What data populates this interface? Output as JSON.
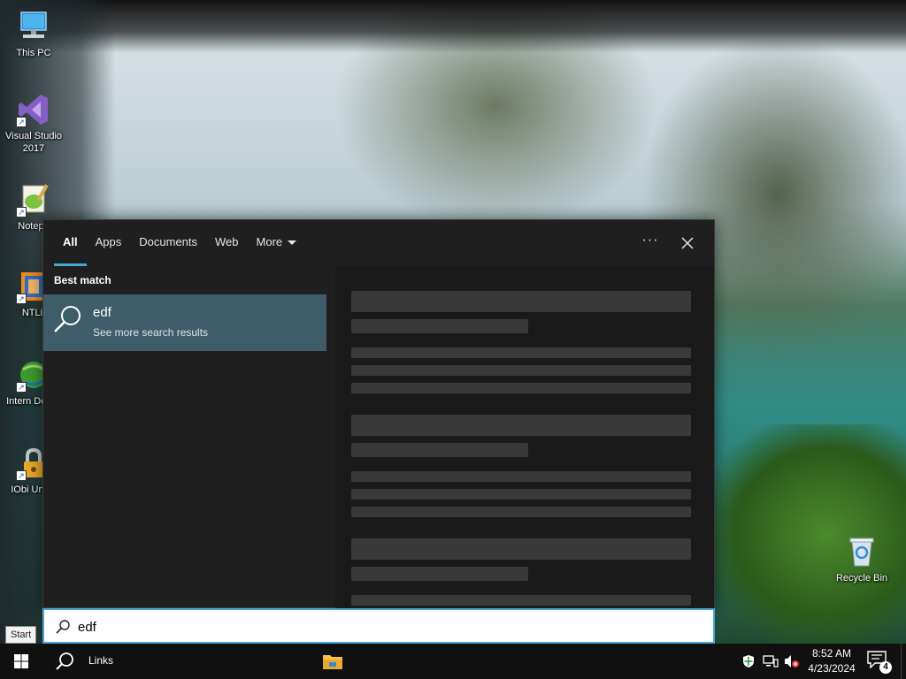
{
  "desktop": {
    "icons": [
      {
        "label": "This PC"
      },
      {
        "label": "Visual Studio 2017"
      },
      {
        "label": "Notepa"
      },
      {
        "label": "NTLit"
      },
      {
        "label": "Intern Downl"
      },
      {
        "label": "IObi Unloc"
      },
      {
        "label": "Recycle Bin"
      }
    ]
  },
  "search": {
    "tabs": [
      {
        "label": "All",
        "active": true
      },
      {
        "label": "Apps"
      },
      {
        "label": "Documents"
      },
      {
        "label": "Web"
      },
      {
        "label": "More"
      }
    ],
    "more_options_label": "···",
    "best_match_label": "Best match",
    "result": {
      "title": "edf",
      "subtitle": "See more search results",
      "icon": "search-icon"
    },
    "query": "edf"
  },
  "tooltip": {
    "start": "Start"
  },
  "taskbar": {
    "links_label": "Links",
    "clock": {
      "time": "8:52 AM",
      "date": "4/23/2024"
    },
    "notification_count": "4"
  },
  "colors": {
    "accent": "#4aa6d8",
    "result_highlight": "#3f5d69",
    "panel_bg": "#1f1f1f",
    "taskbar_bg": "#101010"
  }
}
